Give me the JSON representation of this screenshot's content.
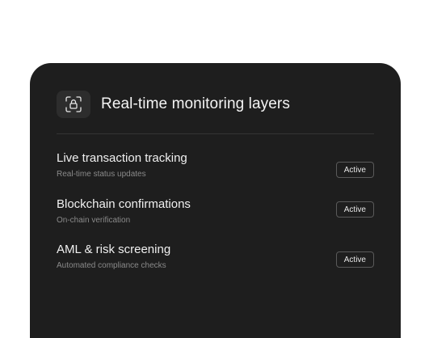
{
  "card": {
    "title": "Real-time monitoring layers",
    "header_icon": "lock-scan-icon",
    "background": "#1e1e1e"
  },
  "layers": [
    {
      "name": "Live transaction tracking",
      "description": "Real-time status updates",
      "status": "Active"
    },
    {
      "name": "Blockchain confirmations",
      "description": "On-chain verification",
      "status": "Active"
    },
    {
      "name": "AML & risk screening",
      "description": "Automated compliance checks",
      "status": "Active"
    }
  ]
}
